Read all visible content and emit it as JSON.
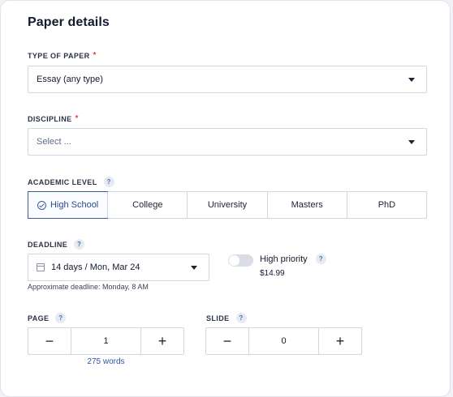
{
  "title": "Paper details",
  "type_of_paper": {
    "label": "TYPE OF PAPER",
    "required_mark": "*",
    "value": "Essay (any type)"
  },
  "discipline": {
    "label": "DISCIPLINE",
    "required_mark": "*",
    "placeholder": "Select ..."
  },
  "academic_level": {
    "label": "ACADEMIC LEVEL",
    "help": "?",
    "options": [
      "High School",
      "College",
      "University",
      "Masters",
      "PhD"
    ],
    "selected": "High School"
  },
  "deadline": {
    "label": "DEADLINE",
    "help": "?",
    "value": "14 days / Mon, Mar 24",
    "approx": "Approximate deadline: Monday, 8 AM"
  },
  "priority": {
    "label": "High priority",
    "help": "?",
    "price": "$14.99",
    "enabled": false
  },
  "page": {
    "label": "PAGE",
    "help": "?",
    "value": "1",
    "minus": "−",
    "plus": "+",
    "words": "275 words"
  },
  "slide": {
    "label": "SLIDE",
    "help": "?",
    "value": "0",
    "minus": "−",
    "plus": "+"
  },
  "colors": {
    "accent": "#3b5da8",
    "required": "#e0473d",
    "link": "#2e54a8"
  }
}
